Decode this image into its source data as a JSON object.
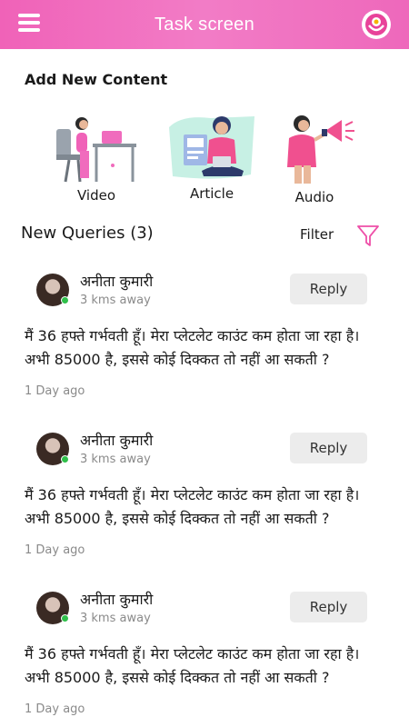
{
  "header": {
    "title": "Task screen",
    "menu_icon": "hamburger-menu-icon",
    "logo_icon": "app-logo-icon",
    "accent_color": "#f06bbd"
  },
  "add_content": {
    "title": "Add New Content",
    "items": [
      {
        "label": "Video",
        "illustration": "woman-at-desk-illustration"
      },
      {
        "label": "Article",
        "illustration": "woman-with-laptop-illustration"
      },
      {
        "label": "Audio",
        "illustration": "woman-with-megaphone-illustration"
      }
    ]
  },
  "queries": {
    "title": "New Queries (3)",
    "filter_label": "Filter",
    "filter_icon": "filter-funnel-icon",
    "items": [
      {
        "name": "अनीता कुमारी",
        "distance": "3 kms away",
        "reply_label": "Reply",
        "text": "मैं 36 हफ्ते गर्भवती हूँ।  मेरा प्लेटलेट काउंट कम होता जा रहा है। अभी 85000 है, इससे कोई दिक्कत तो नहीं आ सकती ?",
        "time": "1 Day ago"
      },
      {
        "name": "अनीता कुमारी",
        "distance": "3 kms away",
        "reply_label": "Reply",
        "text": "मैं 36 हफ्ते गर्भवती हूँ।  मेरा प्लेटलेट काउंट कम होता जा रहा है। अभी 85000 है, इससे कोई दिक्कत तो नहीं आ सकती ?",
        "time": "1 Day ago"
      },
      {
        "name": "अनीता कुमारी",
        "distance": "3 kms away",
        "reply_label": "Reply",
        "text": "मैं 36 हफ्ते गर्भवती हूँ।  मेरा प्लेटलेट काउंट कम होता जा रहा है। अभी 85000 है, इससे कोई दिक्कत तो नहीं आ सकती ?",
        "time": "1 Day ago"
      }
    ]
  }
}
